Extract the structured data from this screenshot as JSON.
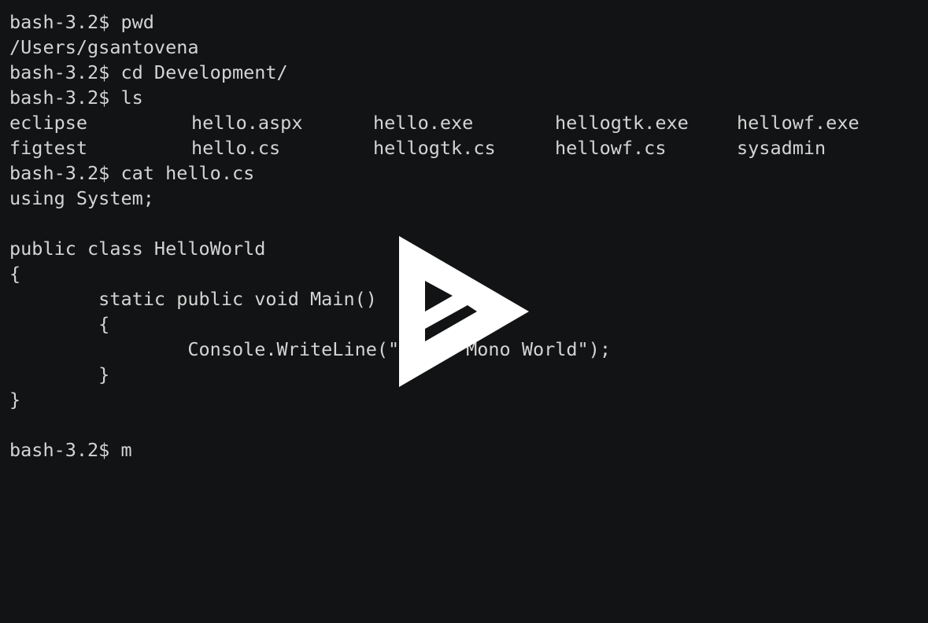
{
  "terminal": {
    "lines": [
      "bash-3.2$ pwd",
      "/Users/gsantovena",
      "bash-3.2$ cd Development/",
      "bash-3.2$ ls",
      "",
      "",
      "bash-3.2$ cat hello.cs",
      "using System;",
      "",
      "public class HelloWorld",
      "{",
      "        static public void Main()",
      "        {",
      "                Console.WriteLine(\"Hello Mono World\");",
      "        }",
      "}",
      "",
      "bash-3.2$ m"
    ],
    "ls_output": [
      [
        "eclipse",
        "hello.aspx",
        "hello.exe",
        "hellogtk.exe",
        "hellowf.exe"
      ],
      [
        "figtest",
        "hello.cs",
        "hellogtk.cs",
        "hellowf.cs",
        "sysadmin"
      ]
    ]
  },
  "overlay": {
    "icon": "play-logo-icon",
    "color": "#ffffff"
  },
  "colors": {
    "background": "#121314",
    "text": "#d4d4d4"
  }
}
